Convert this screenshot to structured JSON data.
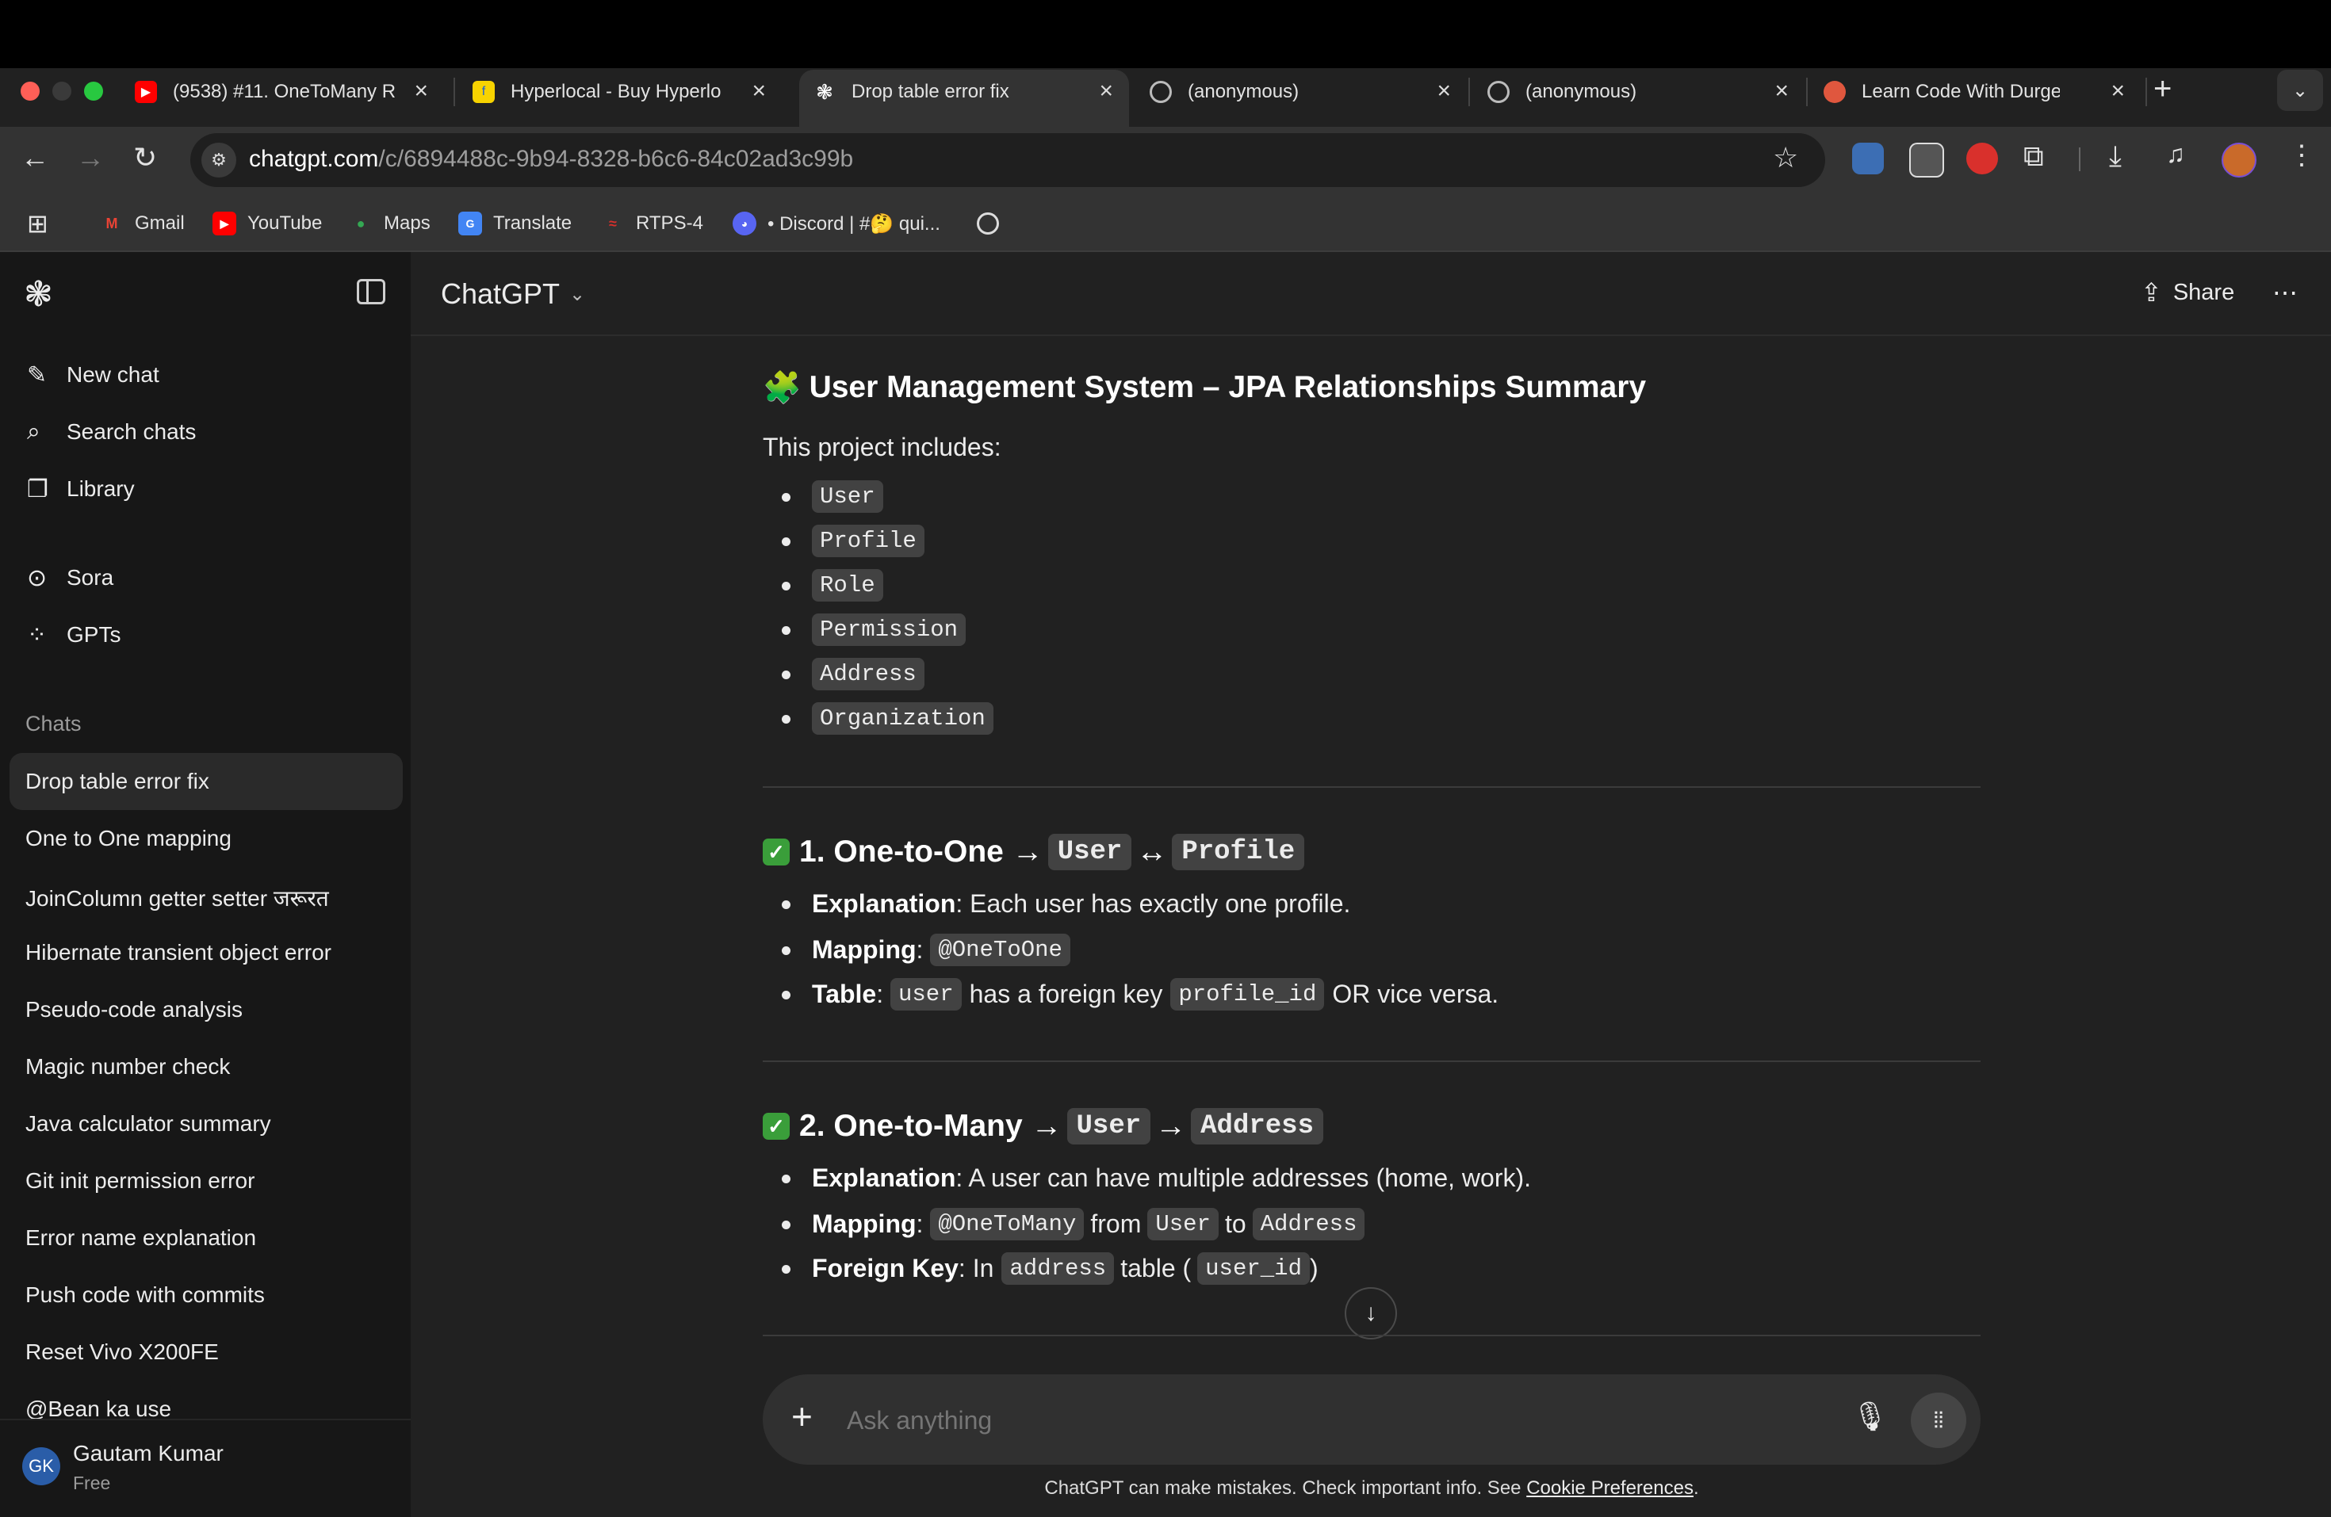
{
  "browser": {
    "tabs": [
      {
        "title": "(9538) #11. OneToMany R",
        "favicon": "youtube-icon",
        "color": "#ff0000"
      },
      {
        "title": "Hyperlocal - Buy Hyperlo",
        "favicon": "flipkart-icon",
        "color": "#f7d300"
      },
      {
        "title": "Drop table error fix",
        "favicon": "chatgpt-icon",
        "color": "#ffffff"
      },
      {
        "title": "(anonymous)",
        "favicon": "globe-icon",
        "color": "#bbbbbb"
      },
      {
        "title": "(anonymous)",
        "favicon": "globe-icon",
        "color": "#bbbbbb"
      },
      {
        "title": "Learn Code With Durgesh",
        "favicon": "lcwd-icon",
        "color": "#e0573e"
      }
    ],
    "url_domain": "chatgpt.com",
    "url_path": "/c/6894488c-9b94-8328-b6c6-84c02ad3c99b",
    "bookmarks": [
      "Gmail",
      "YouTube",
      "Maps",
      "Translate",
      "RTPS-4",
      "• Discord | #🤔 qui..."
    ]
  },
  "sidebar": {
    "nav": [
      {
        "label": "New chat",
        "icon": "pencil-icon"
      },
      {
        "label": "Search chats",
        "icon": "search-icon"
      },
      {
        "label": "Library",
        "icon": "library-icon"
      },
      {
        "label": "Sora",
        "icon": "play-icon"
      },
      {
        "label": "GPTs",
        "icon": "grid-icon"
      }
    ],
    "chats_heading": "Chats",
    "chats": [
      "Drop table error fix",
      "One to One mapping",
      "JoinColumn getter setter जरूरत",
      "Hibernate transient object error",
      "Pseudo-code analysis",
      "Magic number check",
      "Java calculator summary",
      "Git init permission error",
      "Error name explanation",
      "Push code with commits",
      "Reset Vivo X200FE",
      "@Bean ka use"
    ],
    "user": {
      "initials": "GK",
      "name": "Gautam Kumar",
      "plan": "Free"
    }
  },
  "header": {
    "model": "ChatGPT",
    "share_label": "Share"
  },
  "content": {
    "title_emoji": "🧩",
    "title": "User Management System – JPA Relationships Summary",
    "intro": "This project includes:",
    "entities": [
      "User",
      "Profile",
      "Role",
      "Permission",
      "Address",
      "Organization"
    ],
    "s1": {
      "title": "1. One-to-One →",
      "a": "User",
      "arrow": "↔",
      "b": "Profile",
      "exp_label": "Explanation",
      "exp_text": ": Each user has exactly one profile.",
      "map_label": "Mapping",
      "map_code": "@OneToOne",
      "table_label": "Table",
      "table_code1": "user",
      "table_mid": "has a foreign key",
      "table_code2": "profile_id",
      "table_end": "OR vice versa."
    },
    "s2": {
      "title": "2. One-to-Many →",
      "a": "User",
      "arrow": "→",
      "b": "Address",
      "exp_label": "Explanation",
      "exp_text": ": A user can have multiple addresses (home, work).",
      "map_label": "Mapping",
      "map_code": "@OneToMany",
      "map_from": "from",
      "map_a": "User",
      "map_to": "to",
      "map_b": "Address",
      "fk_label": "Foreign Key",
      "fk_in": ": In",
      "fk_code": "address",
      "fk_table": "table (",
      "fk_col": "user_id",
      "fk_close": ")"
    }
  },
  "composer": {
    "placeholder": "Ask anything"
  },
  "footer": {
    "text": "ChatGPT can make mistakes. Check important info. See ",
    "link": "Cookie Preferences",
    "end": "."
  }
}
